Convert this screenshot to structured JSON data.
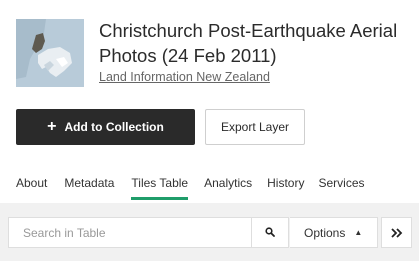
{
  "layer": {
    "title": "Christchurch Post-Earthquake Aerial Photos (24 Feb 2011)",
    "publisher": "Land Information New Zealand"
  },
  "actions": {
    "add_label": "Add to Collection",
    "add_icon": "plus-icon",
    "export_label": "Export Layer"
  },
  "tabs": [
    {
      "label": "About",
      "active": false
    },
    {
      "label": "Metadata",
      "active": false
    },
    {
      "label": "Tiles Table",
      "active": true
    },
    {
      "label": "Analytics",
      "active": false
    },
    {
      "label": "History",
      "active": false
    },
    {
      "label": "Services",
      "active": false
    }
  ],
  "toolbar": {
    "search_placeholder": "Search in Table",
    "search_icon": "search-icon",
    "options_label": "Options",
    "options_icon": "caret-up-icon",
    "expand_icon": "double-chevron-right-icon"
  },
  "colors": {
    "accent": "#1f9d6a",
    "primary_button": "#2a2a2a",
    "toolbar_bg": "#f1f1f1"
  }
}
